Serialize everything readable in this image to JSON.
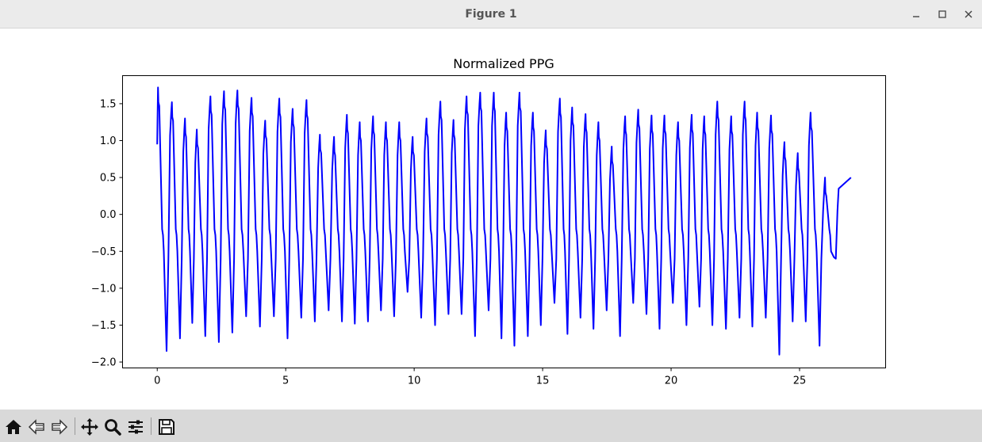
{
  "window": {
    "title": "Figure 1"
  },
  "toolbar": {
    "buttons": [
      {
        "icon": "home-icon",
        "name": "home-button"
      },
      {
        "icon": "back-icon",
        "name": "back-button"
      },
      {
        "icon": "forward-icon",
        "name": "forward-button"
      },
      {
        "icon": "pan-icon",
        "name": "pan-button"
      },
      {
        "icon": "zoom-icon",
        "name": "zoom-button"
      },
      {
        "icon": "configure-subplots-icon",
        "name": "configure-subplots-button"
      },
      {
        "icon": "save-icon",
        "name": "save-button"
      }
    ]
  },
  "colors": {
    "line": "#0000ff",
    "axes": "#000000",
    "toolbar_bg": "#d9d9d9",
    "titlebar_bg": "#ebebeb"
  },
  "chart_data": {
    "type": "line",
    "title": "Normalized PPG",
    "xlabel": "",
    "ylabel": "",
    "xlim": [
      -1.35,
      28.35
    ],
    "ylim": [
      -2.08,
      1.88
    ],
    "xticks": [
      0,
      5,
      10,
      15,
      20,
      25
    ],
    "xtick_labels": [
      "0",
      "5",
      "10",
      "15",
      "20",
      "25"
    ],
    "yticks": [
      -2.0,
      -1.5,
      -1.0,
      -0.5,
      0.0,
      0.5,
      1.0,
      1.5
    ],
    "ytick_labels": [
      "−2.0",
      "−1.5",
      "−1.0",
      "−0.5",
      "0.0",
      "0.5",
      "1.0",
      "1.5"
    ],
    "grid": false,
    "series": [
      {
        "color": "#0000ff",
        "peak_times": [
          0.03,
          0.57,
          1.08,
          1.54,
          2.07,
          2.6,
          3.12,
          3.67,
          4.2,
          4.75,
          5.27,
          5.81,
          6.33,
          6.88,
          7.38,
          7.88,
          8.4,
          8.9,
          9.42,
          9.94,
          10.48,
          11.02,
          11.53,
          12.04,
          12.57,
          13.1,
          13.58,
          14.1,
          14.62,
          15.12,
          15.67,
          16.15,
          16.67,
          17.17,
          17.69,
          18.21,
          18.72,
          19.24,
          19.74,
          20.27,
          20.8,
          21.29,
          21.8,
          22.34,
          22.86,
          23.35,
          23.89,
          24.41,
          24.93,
          25.43,
          25.99,
          26.55
        ],
        "peak_values": [
          1.72,
          1.52,
          1.3,
          1.15,
          1.6,
          1.67,
          1.68,
          1.58,
          1.27,
          1.57,
          1.43,
          1.55,
          1.08,
          1.05,
          1.35,
          1.25,
          1.33,
          1.25,
          1.25,
          1.05,
          1.3,
          1.53,
          1.28,
          1.6,
          1.65,
          1.65,
          1.38,
          1.65,
          1.38,
          1.14,
          1.57,
          1.45,
          1.36,
          1.25,
          0.92,
          1.33,
          1.42,
          1.34,
          1.34,
          1.25,
          1.35,
          1.33,
          1.53,
          1.33,
          1.53,
          1.38,
          1.34,
          0.98,
          0.83,
          1.38,
          0.5
        ],
        "trough_values": [
          -1.85,
          -1.68,
          -1.47,
          -1.65,
          -1.73,
          -1.6,
          -1.38,
          -1.52,
          -1.38,
          -1.68,
          -1.4,
          -1.45,
          -1.3,
          -1.45,
          -1.48,
          -1.45,
          -1.3,
          -1.38,
          -1.05,
          -1.4,
          -1.5,
          -1.35,
          -1.35,
          -1.65,
          -1.3,
          -1.68,
          -1.78,
          -1.65,
          -1.5,
          -1.2,
          -1.62,
          -1.4,
          -1.55,
          -1.3,
          -1.65,
          -1.2,
          -1.35,
          -1.55,
          -1.2,
          -1.5,
          -1.25,
          -1.5,
          -1.55,
          -1.4,
          -1.52,
          -1.4,
          -1.9,
          -1.45,
          -1.45,
          -1.78,
          -0.58
        ],
        "start": [
          0.0,
          0.95
        ],
        "end": [
          27.0,
          0.5
        ]
      }
    ]
  }
}
